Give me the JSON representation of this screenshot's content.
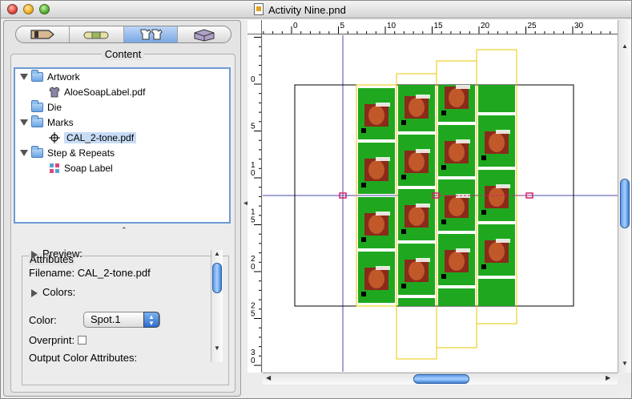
{
  "window": {
    "title": "Activity Nine.pnd"
  },
  "toolbar": {
    "buttons": [
      {
        "name": "info",
        "icon": "info-tag-icon"
      },
      {
        "name": "marks",
        "icon": "bandage-icon"
      },
      {
        "name": "layout",
        "icon": "shirts-icon",
        "active": true
      },
      {
        "name": "output",
        "icon": "boxes-icon"
      }
    ]
  },
  "content": {
    "heading": "Content",
    "tree": [
      {
        "label": "Artwork",
        "type": "folder",
        "expanded": true
      },
      {
        "label": "AloeSoapLabel.pdf",
        "type": "file-shirt"
      },
      {
        "label": "Die",
        "type": "folder",
        "expanded": false
      },
      {
        "label": "Marks",
        "type": "folder",
        "expanded": true
      },
      {
        "label": "CAL_2-tone.pdf",
        "type": "file-crosshair",
        "selected": true
      },
      {
        "label": "Step & Repeats",
        "type": "folder",
        "expanded": true
      },
      {
        "label": "Soap Label",
        "type": "file-grid"
      }
    ]
  },
  "attributes": {
    "heading": "Attributes",
    "preview_label": "Preview:",
    "filename_label": "Filename: CAL_2-tone.pdf",
    "colors_label": "Colors:",
    "color_label": "Color:",
    "color_value": "Spot.1",
    "overprint_label": "Overprint:",
    "output_label": "Output Color Attributes:"
  },
  "ruler": {
    "top_ticks": [
      "0",
      "5",
      "10",
      "15",
      "20",
      "25",
      "30"
    ],
    "left_ticks": [
      "0",
      "5",
      "10",
      "15",
      "20",
      "25",
      "30"
    ]
  },
  "colors": {
    "label_green": "#1fa81f",
    "outline_yellow": "#e8c800",
    "guide_blue": "#4a4aa8",
    "mark_pink": "#d0206a",
    "selection_blue": "#c8dcf6"
  }
}
